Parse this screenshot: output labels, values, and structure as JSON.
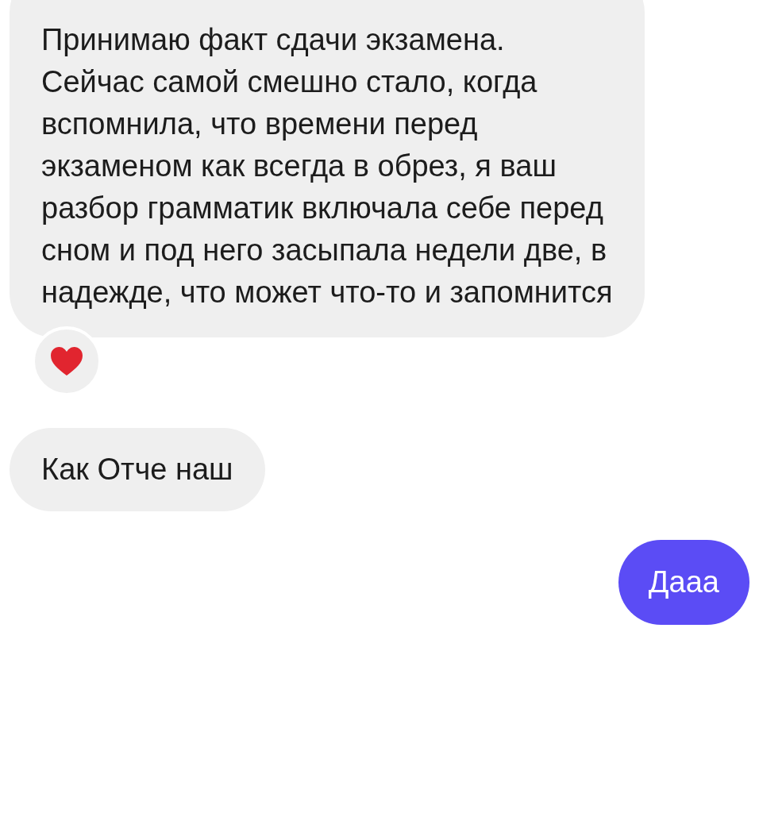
{
  "messages": [
    {
      "kind": "incoming",
      "text": "Принимаю факт сдачи экзамена. Сейчас самой смешно стало, когда вспомнила, что времени перед экзаменом как всегда в обрез, я ваш разбор грамматик включала себе перед сном и под него засыпала недели две, в надежде, что может что-то и запомнится",
      "reacted": true
    },
    {
      "kind": "incoming",
      "text": "Как Отче наш",
      "reacted": false
    },
    {
      "kind": "outgoing",
      "text": "Дааа",
      "reacted": false
    }
  ]
}
